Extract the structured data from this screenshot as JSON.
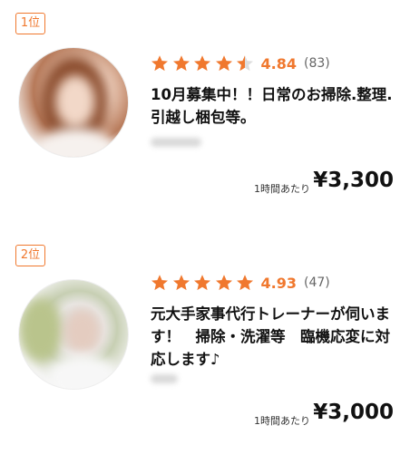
{
  "listings": [
    {
      "rank": "1位",
      "rating": 4.84,
      "rating_text": "4.84",
      "review_count": "(83)",
      "stars": [
        1,
        1,
        1,
        1,
        0.5
      ],
      "title": "10月募集中！！日常のお掃除.整理.引越し梱包等。",
      "price_unit": "1時間あたり",
      "price": "¥3,300"
    },
    {
      "rank": "2位",
      "rating": 4.93,
      "rating_text": "4.93",
      "review_count": "(47)",
      "stars": [
        1,
        1,
        1,
        1,
        1
      ],
      "title": "元大手家事代行トレーナーが伺います！　掃除・洗濯等　臨機応変に対応します♪",
      "price_unit": "1時間あたり",
      "price": "¥3,000"
    }
  ],
  "colors": {
    "accent": "#f0782e",
    "star_empty": "#dddddd"
  }
}
